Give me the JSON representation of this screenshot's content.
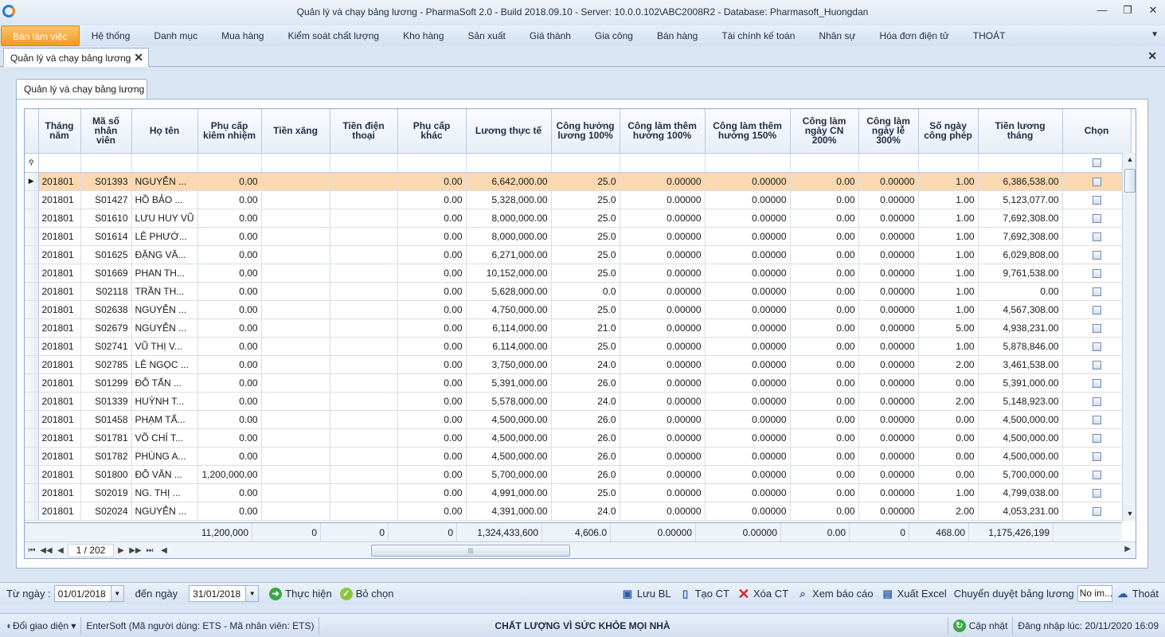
{
  "window": {
    "title": "Quản lý và chạy bảng lương - PharmaSoft 2.0 - Build 2018.09.10 - Server: 10.0.0.102\\ABC2008R2 - Database: Pharmasoft_Huongdan",
    "minimize": "—",
    "restore": "❐",
    "close": "✕"
  },
  "menu": [
    {
      "label": "Bàn làm việc",
      "active": true
    },
    {
      "label": "Hệ thống"
    },
    {
      "label": "Danh mục"
    },
    {
      "label": "Mua hàng"
    },
    {
      "label": "Kiểm soát chất lượng"
    },
    {
      "label": "Kho hàng"
    },
    {
      "label": "Sản xuất"
    },
    {
      "label": "Giá thành"
    },
    {
      "label": "Gia công"
    },
    {
      "label": "Bán hàng"
    },
    {
      "label": "Tài chính kế toán"
    },
    {
      "label": "Nhân sự"
    },
    {
      "label": "Hóa đơn điện tử"
    },
    {
      "label": "THOÁT"
    }
  ],
  "doc_tab": {
    "label": "Quản lý và chạy bảng lương",
    "close": "✕"
  },
  "inner_tab": {
    "label": "Quản lý và chạy bảng lương"
  },
  "grid": {
    "columns": [
      "Tháng năm",
      "Mã số nhân viên",
      "Họ tên",
      "Phụ cấp kiêm nhiệm",
      "Tiền xăng",
      "Tiền điện thoại",
      "Phụ cấp khác",
      "Lương thực tế",
      "Công hưởng lương 100%",
      "Công làm thêm hưởng 100%",
      "Công làm thêm hưởng 150%",
      "Công làm ngày CN 200%",
      "Công làm ngày lễ 300%",
      "Số ngày công phép",
      "Tiền lương tháng",
      "Chọn"
    ],
    "rows": [
      [
        "201801",
        "S01393",
        "NGUYỄN ...",
        "0.00",
        "",
        "",
        "0.00",
        "6,642,000.00",
        "25.0",
        "0.00000",
        "0.00000",
        "0.00",
        "0.00000",
        "1.00",
        "6,386,538.00"
      ],
      [
        "201801",
        "S01427",
        "HỒ BẢO ...",
        "0.00",
        "",
        "",
        "0.00",
        "5,328,000.00",
        "25.0",
        "0.00000",
        "0.00000",
        "0.00",
        "0.00000",
        "1.00",
        "5,123,077.00"
      ],
      [
        "201801",
        "S01610",
        "LƯU HUY VŨ",
        "0.00",
        "",
        "",
        "0.00",
        "8,000,000.00",
        "25.0",
        "0.00000",
        "0.00000",
        "0.00",
        "0.00000",
        "1.00",
        "7,692,308.00"
      ],
      [
        "201801",
        "S01614",
        "LÊ PHƯỚ...",
        "0.00",
        "",
        "",
        "0.00",
        "8,000,000.00",
        "25.0",
        "0.00000",
        "0.00000",
        "0.00",
        "0.00000",
        "1.00",
        "7,692,308.00"
      ],
      [
        "201801",
        "S01625",
        "ĐẶNG VĂ...",
        "0.00",
        "",
        "",
        "0.00",
        "6,271,000.00",
        "25.0",
        "0.00000",
        "0.00000",
        "0.00",
        "0.00000",
        "1.00",
        "6,029,808.00"
      ],
      [
        "201801",
        "S01669",
        "PHAN TH...",
        "0.00",
        "",
        "",
        "0.00",
        "10,152,000.00",
        "25.0",
        "0.00000",
        "0.00000",
        "0.00",
        "0.00000",
        "1.00",
        "9,761,538.00"
      ],
      [
        "201801",
        "S02118",
        "TRẦN TH...",
        "0.00",
        "",
        "",
        "0.00",
        "5,628,000.00",
        "0.0",
        "0.00000",
        "0.00000",
        "0.00",
        "0.00000",
        "1.00",
        "0.00"
      ],
      [
        "201801",
        "S02638",
        "NGUYỄN ...",
        "0.00",
        "",
        "",
        "0.00",
        "4,750,000.00",
        "25.0",
        "0.00000",
        "0.00000",
        "0.00",
        "0.00000",
        "1.00",
        "4,567,308.00"
      ],
      [
        "201801",
        "S02679",
        "NGUYỄN ...",
        "0.00",
        "",
        "",
        "0.00",
        "6,114,000.00",
        "21.0",
        "0.00000",
        "0.00000",
        "0.00",
        "0.00000",
        "5.00",
        "4,938,231.00"
      ],
      [
        "201801",
        "S02741",
        "VŨ THỊ V...",
        "0.00",
        "",
        "",
        "0.00",
        "6,114,000.00",
        "25.0",
        "0.00000",
        "0.00000",
        "0.00",
        "0.00000",
        "1.00",
        "5,878,846.00"
      ],
      [
        "201801",
        "S02785",
        "LÊ NGỌC ...",
        "0.00",
        "",
        "",
        "0.00",
        "3,750,000.00",
        "24.0",
        "0.00000",
        "0.00000",
        "0.00",
        "0.00000",
        "2.00",
        "3,461,538.00"
      ],
      [
        "201801",
        "S01299",
        "ĐỖ TẤN ...",
        "0.00",
        "",
        "",
        "0.00",
        "5,391,000.00",
        "26.0",
        "0.00000",
        "0.00000",
        "0.00",
        "0.00000",
        "0.00",
        "5,391,000.00"
      ],
      [
        "201801",
        "S01339",
        "HUỲNH T...",
        "0.00",
        "",
        "",
        "0.00",
        "5,578,000.00",
        "24.0",
        "0.00000",
        "0.00000",
        "0.00",
        "0.00000",
        "2.00",
        "5,148,923.00"
      ],
      [
        "201801",
        "S01458",
        "PHẠM TẤ...",
        "0.00",
        "",
        "",
        "0.00",
        "4,500,000.00",
        "26.0",
        "0.00000",
        "0.00000",
        "0.00",
        "0.00000",
        "0.00",
        "4,500,000.00"
      ],
      [
        "201801",
        "S01781",
        "VÕ CHÍ T...",
        "0.00",
        "",
        "",
        "0.00",
        "4,500,000.00",
        "26.0",
        "0.00000",
        "0.00000",
        "0.00",
        "0.00000",
        "0.00",
        "4,500,000.00"
      ],
      [
        "201801",
        "S01782",
        "PHÙNG A...",
        "0.00",
        "",
        "",
        "0.00",
        "4,500,000.00",
        "26.0",
        "0.00000",
        "0.00000",
        "0.00",
        "0.00000",
        "0.00",
        "4,500,000.00"
      ],
      [
        "201801",
        "S01800",
        "ĐỖ VĂN ...",
        "1,200,000.00",
        "",
        "",
        "0.00",
        "5,700,000.00",
        "26.0",
        "0.00000",
        "0.00000",
        "0.00",
        "0.00000",
        "0.00",
        "5,700,000.00"
      ],
      [
        "201801",
        "S02019",
        "NG. THỊ ...",
        "0.00",
        "",
        "",
        "0.00",
        "4,991,000.00",
        "25.0",
        "0.00000",
        "0.00000",
        "0.00",
        "0.00000",
        "1.00",
        "4,799,038.00"
      ],
      [
        "201801",
        "S02024",
        "NGUYỄN ...",
        "0.00",
        "",
        "",
        "0.00",
        "4,391,000.00",
        "24.0",
        "0.00000",
        "0.00000",
        "0.00",
        "0.00000",
        "2.00",
        "4,053,231.00"
      ]
    ],
    "totals": [
      "11,200,000",
      "0",
      "0",
      "0",
      "1,324,433,600",
      "4,606.0",
      "0.00000",
      "0.00000",
      "0.00",
      "0",
      "468.00",
      "1,175,426,199"
    ],
    "pager": "1 / 202"
  },
  "toolbar": {
    "from_label": "Từ ngày :",
    "from_value": "01/01/2018",
    "to_label": "đến ngày",
    "to_value": "31/01/2018",
    "run": "Thực hiện",
    "unselect": "Bỏ chọn",
    "save": "Lưu BL",
    "create": "Tạo CT",
    "delete": "Xóa CT",
    "report": "Xem báo cáo",
    "excel": "Xuất Excel",
    "approve": "Chuyển duyệt bảng lương",
    "approve_combo": "No im...",
    "exit": "Thoát"
  },
  "status": {
    "change_ui": "Đổi giao diện",
    "user": "EnterSoft (Mã người dùng: ETS - Mã nhân viên: ETS)",
    "slogan": "CHẤT LƯỢNG VÌ SỨC KHỎE MỌI NHÀ",
    "update": "Cập nhật",
    "login": "Đăng nhập lúc: 20/11/2020 16:09"
  }
}
